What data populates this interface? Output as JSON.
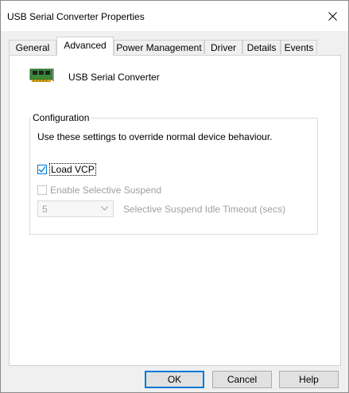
{
  "window": {
    "title": "USB Serial Converter Properties"
  },
  "tabs": [
    {
      "label": "General"
    },
    {
      "label": "Advanced"
    },
    {
      "label": "Power Management"
    },
    {
      "label": "Driver"
    },
    {
      "label": "Details"
    },
    {
      "label": "Events"
    }
  ],
  "active_tab": "Advanced",
  "device": {
    "name": "USB Serial Converter",
    "icon": "usb-device-icon"
  },
  "configuration": {
    "legend": "Configuration",
    "description": "Use these settings to override normal device behaviour.",
    "load_vcp": {
      "label": "Load VCP",
      "checked": true
    },
    "selective_suspend": {
      "label": "Enable Selective Suspend",
      "checked": false,
      "enabled": false
    },
    "idle_timeout": {
      "value": "5",
      "label": "Selective Suspend Idle Timeout (secs)",
      "enabled": false
    }
  },
  "buttons": {
    "ok": "OK",
    "cancel": "Cancel",
    "help": "Help"
  },
  "colors": {
    "accent": "#0078d7",
    "disabled_text": "#a0a0a0"
  }
}
